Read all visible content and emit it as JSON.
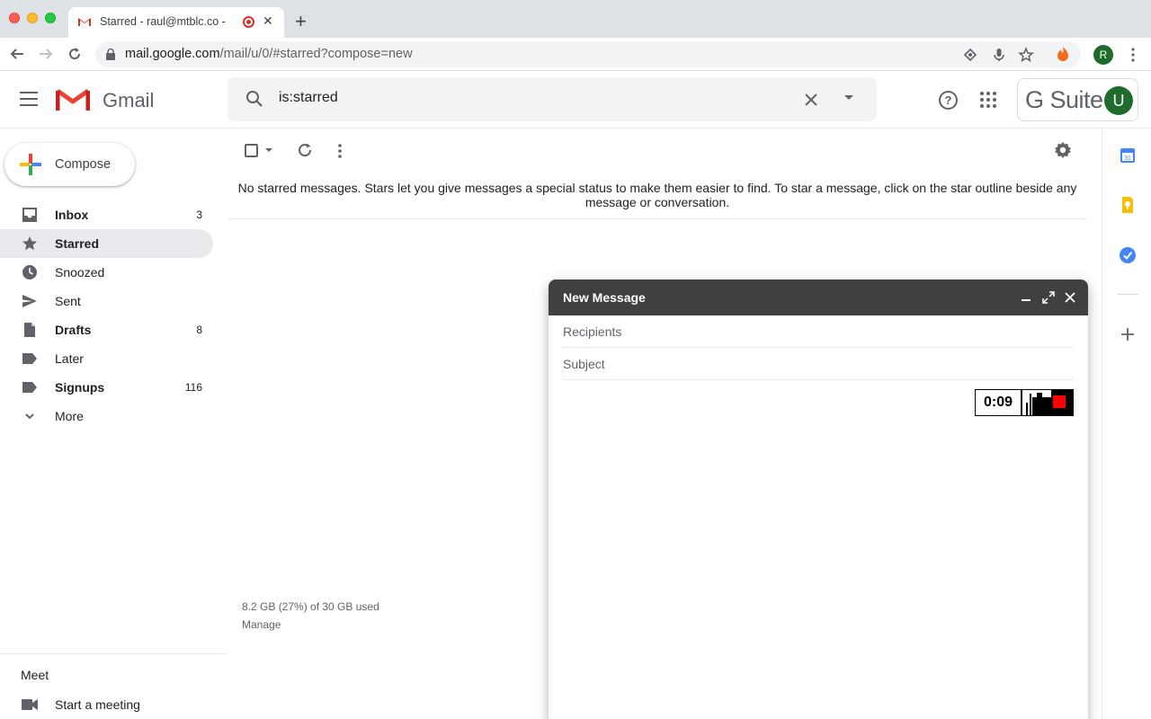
{
  "browser": {
    "tab_title": "Starred - raul@mtblc.co - ",
    "tab_close": "✕",
    "new_tab": "+",
    "url_host": "mail.google.com",
    "url_path": "/mail/u/0/#starred?compose=new",
    "profile_initial": "R"
  },
  "header": {
    "app_name": "Gmail",
    "search_value": "is:starred",
    "help": "?",
    "brand": "G Suite",
    "avatar_initial": "U"
  },
  "sidebar": {
    "compose_label": "Compose",
    "items": [
      {
        "label": "Inbox",
        "count": "3",
        "icon": "inbox-icon"
      },
      {
        "label": "Starred",
        "count": "",
        "icon": "star-icon"
      },
      {
        "label": "Snoozed",
        "count": "",
        "icon": "clock-icon"
      },
      {
        "label": "Sent",
        "count": "",
        "icon": "send-icon"
      },
      {
        "label": "Drafts",
        "count": "8",
        "icon": "draft-icon"
      },
      {
        "label": "Later",
        "count": "",
        "icon": "label-icon"
      },
      {
        "label": "Signups",
        "count": "116",
        "icon": "label-icon"
      },
      {
        "label": "More",
        "count": "",
        "icon": "chevron-down-icon"
      }
    ],
    "meet_title": "Meet",
    "meet_start": "Start a meeting"
  },
  "main": {
    "empty_message": "No starred messages. Stars let you give messages a special status to make them easier to find. To star a message, click on the star outline beside any message or conversation.",
    "storage": "8.2 GB (27%) of 30 GB used",
    "manage": "Manage"
  },
  "compose": {
    "title": "New Message",
    "recipients_placeholder": "Recipients",
    "subject_placeholder": "Subject",
    "recording_time": "0:09"
  },
  "colors": {
    "accent_red": "#d93025",
    "avatar_green": "#1e6b2b",
    "compose_header": "#404040"
  }
}
